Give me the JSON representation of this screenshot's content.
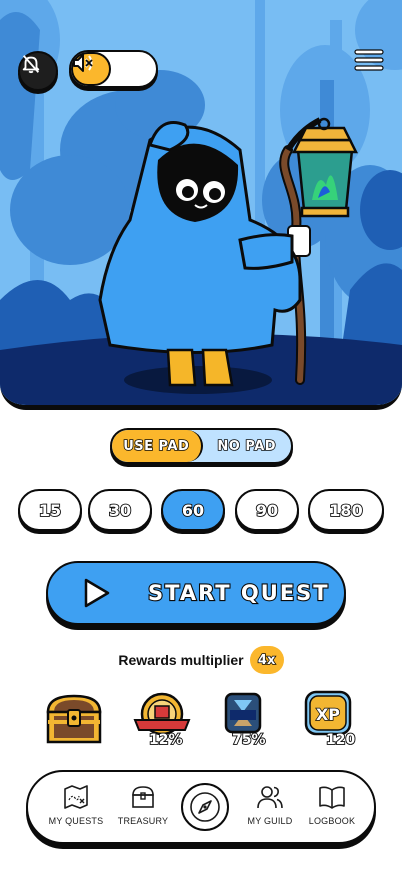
{
  "header": {
    "bell_icon": "bell-off-icon",
    "sound_on_icon": "speaker-wave-icon",
    "sound_off_icon": "speaker-mute-icon",
    "menu_icon": "hamburger-menu-icon"
  },
  "pad_toggle": {
    "options": [
      "USE PAD",
      "NO PAD"
    ],
    "selected": "USE PAD"
  },
  "durations": {
    "options": [
      "15",
      "30",
      "60",
      "90",
      "180"
    ],
    "selected": "60"
  },
  "start_button": {
    "label": "START QUEST",
    "icon": "play-icon"
  },
  "rewards": {
    "label": "Rewards multiplier",
    "multiplier": "4x",
    "items": [
      {
        "name": "treasure-chest",
        "value": ""
      },
      {
        "name": "badge",
        "value": "12%"
      },
      {
        "name": "hourglass-badge",
        "value": "75%"
      },
      {
        "name": "xp",
        "value": "120"
      }
    ]
  },
  "nav": {
    "items": [
      {
        "label": "MY QUESTS",
        "icon": "map-icon"
      },
      {
        "label": "TREASURY",
        "icon": "chest-icon"
      },
      {
        "label": "",
        "icon": "compass-icon"
      },
      {
        "label": "MY GUILD",
        "icon": "users-icon"
      },
      {
        "label": "LOGBOOK",
        "icon": "book-icon"
      }
    ]
  },
  "colors": {
    "accent_blue": "#3ea0f2",
    "accent_yellow": "#fbb72c",
    "outline": "#0b0b0b",
    "sky": "#6fb7f2",
    "forest_dark": "#0e2a6b"
  }
}
